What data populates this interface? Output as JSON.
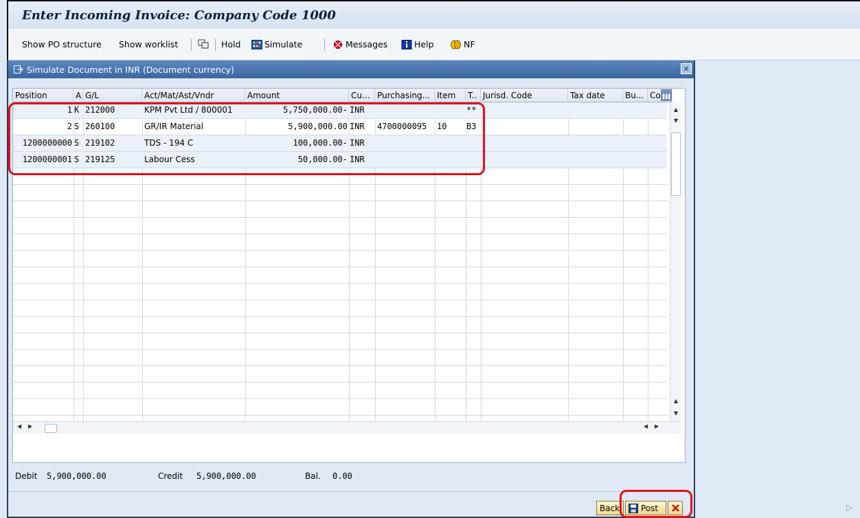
{
  "window": {
    "title": "Enter Incoming Invoice: Company Code 1000"
  },
  "toolbar": {
    "show_po_structure": "Show PO structure",
    "show_worklist": "Show worklist",
    "hold": "Hold",
    "simulate": "Simulate",
    "messages": "Messages",
    "help": "Help",
    "nf": "NF"
  },
  "dialog": {
    "title": "Simulate Document in INR (Document currency)",
    "columns": [
      "Position",
      "A",
      "G/L",
      "Act/Mat/Ast/Vndr",
      "Amount",
      "Cu...",
      "Purchasing...",
      "Item",
      "T..",
      "Jurisd. Code",
      "Tax date",
      "Bu...",
      "Co"
    ],
    "rows": [
      {
        "position": "1",
        "a": "K",
        "gl": "212000",
        "account": "KPM Pvt Ltd / 800001",
        "amount": "5,750,000.00-",
        "currency": "INR",
        "purchasing": "",
        "item": "",
        "tax": "**"
      },
      {
        "position": "2",
        "a": "S",
        "gl": "260100",
        "account": "GR/IR Material",
        "amount": "5,900,000.00",
        "currency": "INR",
        "purchasing": "4700000095",
        "item": "10",
        "tax": "B3"
      },
      {
        "position": "1200000000",
        "a": "S",
        "gl": "219102",
        "account": "TDS - 194 C",
        "amount": "100,000.00-",
        "currency": "INR",
        "purchasing": "",
        "item": "",
        "tax": ""
      },
      {
        "position": "1200000001",
        "a": "S",
        "gl": "219125",
        "account": "Labour Cess",
        "amount": "50,000.00-",
        "currency": "INR",
        "purchasing": "",
        "item": "",
        "tax": ""
      }
    ],
    "totals": {
      "debit_label": "Debit",
      "debit": "5,900,000.00",
      "credit_label": "Credit",
      "credit": "5,900,000.00",
      "bal_label": "Bal.",
      "bal": "0.00"
    },
    "buttons": {
      "back": "Back",
      "post": "Post"
    }
  },
  "colors": {
    "highlight": "#e20e1b",
    "dialog_title": "#3a679f"
  }
}
